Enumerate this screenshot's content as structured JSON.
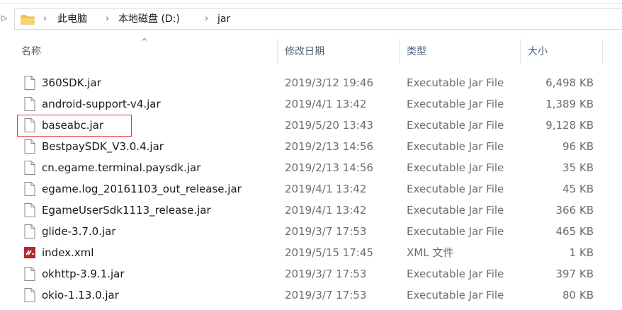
{
  "breadcrumb": {
    "items": [
      "此电脑",
      "本地磁盘 (D:)",
      "jar"
    ]
  },
  "columns": {
    "name": "名称",
    "date": "修改日期",
    "type": "类型",
    "size": "大小"
  },
  "files": [
    {
      "name": "360SDK.jar",
      "date": "2019/3/12 19:46",
      "type": "Executable Jar File",
      "size": "6,498 KB",
      "icon": "file-icon"
    },
    {
      "name": "android-support-v4.jar",
      "date": "2019/4/1 13:42",
      "type": "Executable Jar File",
      "size": "1,389 KB",
      "icon": "file-icon"
    },
    {
      "name": "baseabc.jar",
      "date": "2019/5/20 13:43",
      "type": "Executable Jar File",
      "size": "9,128 KB",
      "icon": "file-icon"
    },
    {
      "name": "BestpaySDK_V3.0.4.jar",
      "date": "2019/2/13 14:56",
      "type": "Executable Jar File",
      "size": "96 KB",
      "icon": "file-icon"
    },
    {
      "name": "cn.egame.terminal.paysdk.jar",
      "date": "2019/2/13 14:56",
      "type": "Executable Jar File",
      "size": "35 KB",
      "icon": "file-icon"
    },
    {
      "name": "egame.log_20161103_out_release.jar",
      "date": "2019/4/1 13:42",
      "type": "Executable Jar File",
      "size": "45 KB",
      "icon": "file-icon"
    },
    {
      "name": "EgameUserSdk1113_release.jar",
      "date": "2019/4/1 13:42",
      "type": "Executable Jar File",
      "size": "366 KB",
      "icon": "file-icon"
    },
    {
      "name": "glide-3.7.0.jar",
      "date": "2019/3/7 17:53",
      "type": "Executable Jar File",
      "size": "465 KB",
      "icon": "file-icon"
    },
    {
      "name": "index.xml",
      "date": "2019/5/15 17:45",
      "type": "XML 文件",
      "size": "1 KB",
      "icon": "xml-file-icon"
    },
    {
      "name": "okhttp-3.9.1.jar",
      "date": "2019/3/7 17:53",
      "type": "Executable Jar File",
      "size": "397 KB",
      "icon": "file-icon"
    },
    {
      "name": "okio-1.13.0.jar",
      "date": "2019/3/7 17:53",
      "type": "Executable Jar File",
      "size": "80 KB",
      "icon": "file-icon"
    }
  ],
  "highlighted_file": "baseabc.jar",
  "colors": {
    "highlight_border": "#e0403a",
    "folder": "#f5c542",
    "xml_icon": "#b3282d",
    "header_text": "#4c607a"
  }
}
